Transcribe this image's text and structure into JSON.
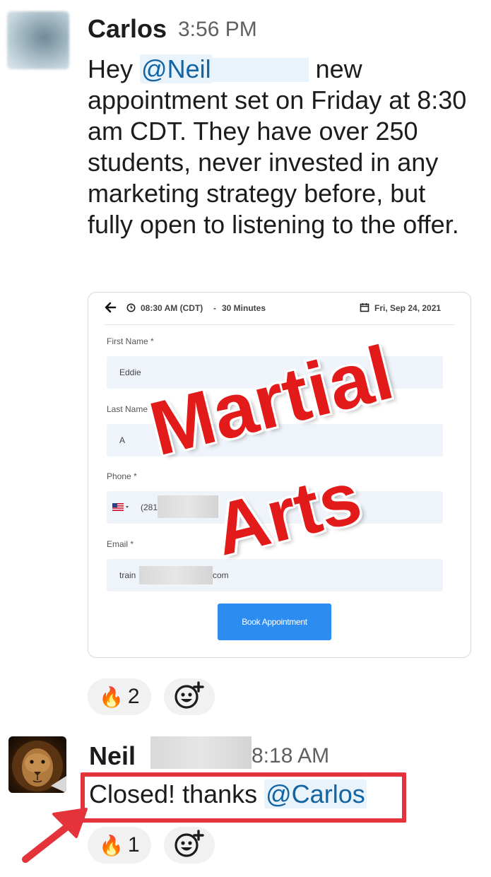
{
  "message1": {
    "author": "Carlos",
    "time": "3:56 PM",
    "text_start": "Hey ",
    "mention": "@Neil",
    "text_rest": " new appointment set on Friday at 8:30 am CDT. They have over 250 students, never invested in any marketing strategy before, but fully open to listening to the offer."
  },
  "card": {
    "header_time": "08:30 AM (CDT)",
    "header_sep": "-",
    "header_duration": "30 Minutes",
    "header_date": "Fri, Sep 24, 2021",
    "fields": [
      {
        "label": "First Name *",
        "value": "Eddie"
      },
      {
        "label": "Last Name *",
        "value": "A"
      },
      {
        "label": "Phone *",
        "value": "(281"
      },
      {
        "label": "Email *",
        "value_start": "train",
        "value_end": "com"
      }
    ],
    "button": "Book Appointment"
  },
  "overlay": {
    "line1": "Martial",
    "line2": "Arts"
  },
  "reactions1": {
    "fire_count": "2"
  },
  "message2": {
    "author": "Neil",
    "time": "8:18 AM",
    "text": "Closed! thanks ",
    "mention": "@Carlos"
  },
  "reactions2": {
    "fire_count": "1"
  },
  "colors": {
    "mention": "#1264a3",
    "mention_bg": "#e8f3fb",
    "highlight": "#e4333a",
    "button": "#2d8cf0",
    "overlay_text": "#e21a1a"
  },
  "icons": [
    "fire-icon",
    "add-reaction-icon",
    "back-arrow-icon",
    "clock-icon",
    "calendar-icon",
    "us-flag-icon"
  ]
}
